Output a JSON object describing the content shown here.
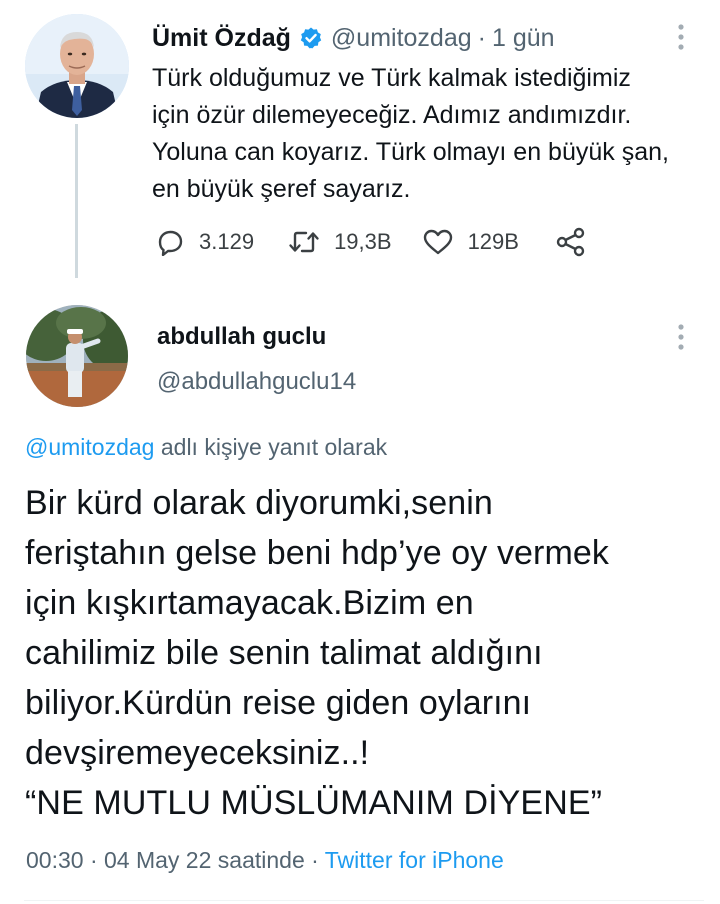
{
  "colors": {
    "accent": "#1d9bf0",
    "secondary_text": "#536471",
    "primary_text": "#0f1419",
    "thread_line": "#cfd9de"
  },
  "parent_tweet": {
    "avatar_icon": "user-photo-avatar",
    "display_name": "Ümit Özdağ",
    "verified_icon": "verified-badge-icon",
    "handle": "@umitozdag",
    "separator": "·",
    "time": "1 gün",
    "menu_icon": "more-vertical-icon",
    "text_lines": [
      "Türk olduğumuz ve Türk kalmak istediğimiz",
      "için özür dilemeyeceğiz. Adımız andımızdır.",
      "Yoluna can koyarız. Türk olmayı en büyük şan,",
      "en büyük şeref sayarız."
    ],
    "actions": {
      "reply": {
        "icon": "reply-icon",
        "count": "3.129"
      },
      "retweet": {
        "icon": "retweet-icon",
        "count": "19,3B"
      },
      "like": {
        "icon": "heart-icon",
        "count": "129B"
      },
      "share": {
        "icon": "share-icon"
      }
    }
  },
  "reply_tweet": {
    "avatar_icon": "user-photo-avatar",
    "display_name": "abdullah guclu",
    "handle": "@abdullahguclu14",
    "menu_icon": "more-vertical-icon",
    "reply_context": {
      "mention": "@umitozdag",
      "suffix": " adlı kişiye yanıt olarak"
    },
    "text_lines": [
      "Bir kürd olarak diyorumki,senin",
      "feriştahın gelse beni hdp’ye oy vermek",
      "için kışkırtamayacak.Bizim en",
      "cahilimiz bile senin talimat aldığını",
      "biliyor.Kürdün reise giden oylarını",
      "devşiremeyeceksiniz..!",
      "“NE MUTLU MÜSLÜMANIM DİYENE”"
    ],
    "timestamp": "00:30 · 04 May 22 saatinde",
    "meta_separator": " · ",
    "source": "Twitter for iPhone"
  }
}
